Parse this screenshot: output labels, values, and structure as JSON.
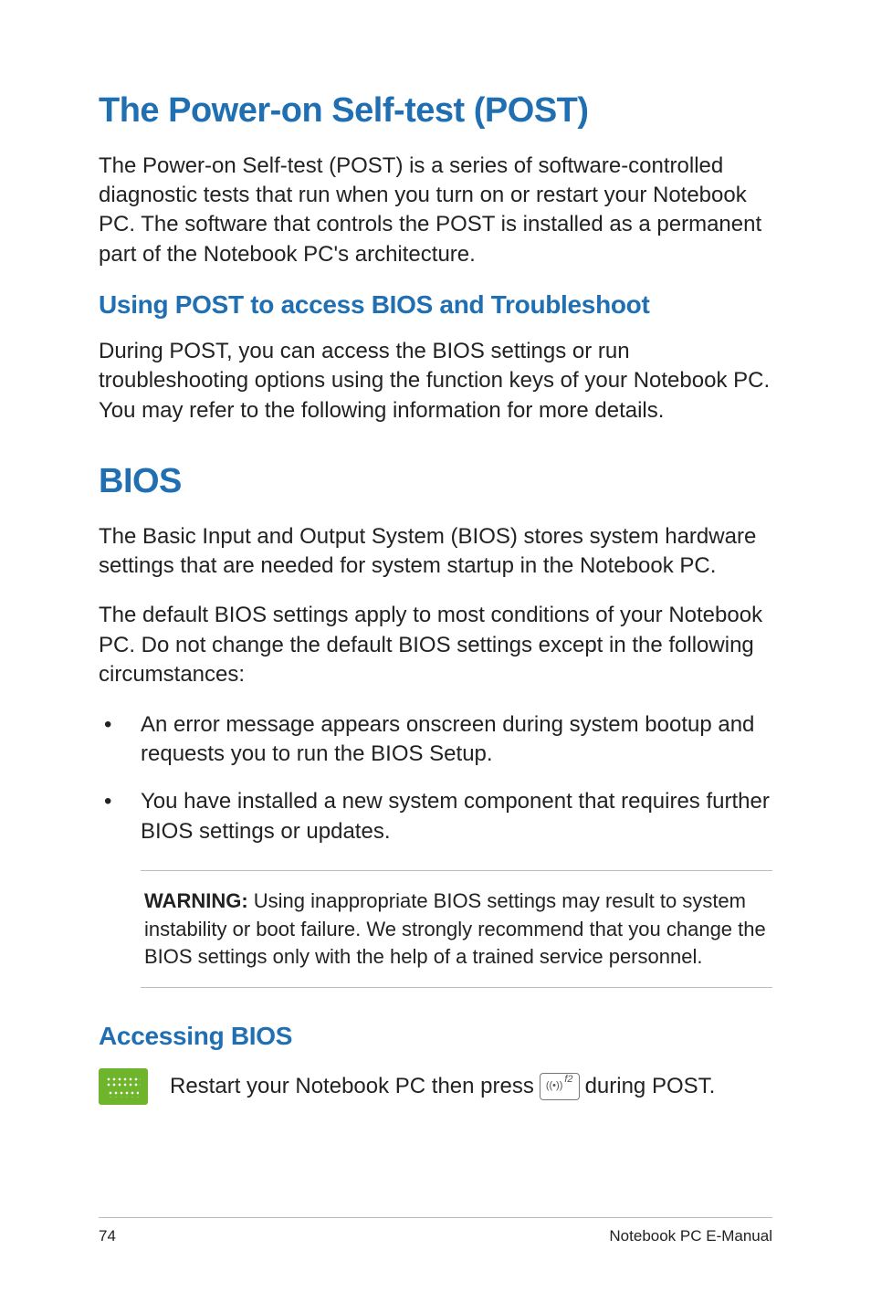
{
  "section1": {
    "title": "The Power-on Self-test (POST)",
    "intro": "The Power-on Self-test (POST)  is a series of software-controlled diagnostic tests that run when you turn on or restart your Notebook PC. The software that controls the POST is installed as a permanent part of the Notebook PC's architecture.",
    "sub": {
      "title": "Using POST to access BIOS and Troubleshoot",
      "body": "During POST, you can access the BIOS settings or run troubleshooting options using the function keys of your Notebook PC. You may refer to the following information for more details."
    }
  },
  "section2": {
    "title": "BIOS",
    "p1": "The Basic Input and Output System (BIOS) stores system hardware settings that are needed for system startup in the Notebook PC.",
    "p2": "The default BIOS settings apply to most conditions of your Notebook PC. Do not change the default BIOS settings except in the following circumstances:",
    "bullets": [
      "An error message appears onscreen during system bootup and requests you to run the BIOS Setup.",
      "You have installed a new system component that requires further BIOS settings or updates."
    ],
    "warning": {
      "label": "WARNING:",
      "text": " Using inappropriate BIOS settings may result to system instability or boot failure. We strongly recommend that you change the BIOS settings only with the help of a trained service personnel."
    },
    "access": {
      "title": "Accessing BIOS",
      "pre": "Restart your Notebook PC then press ",
      "key_label": "f2",
      "post": " during POST."
    }
  },
  "footer": {
    "page": "74",
    "doc": "Notebook PC E-Manual"
  }
}
